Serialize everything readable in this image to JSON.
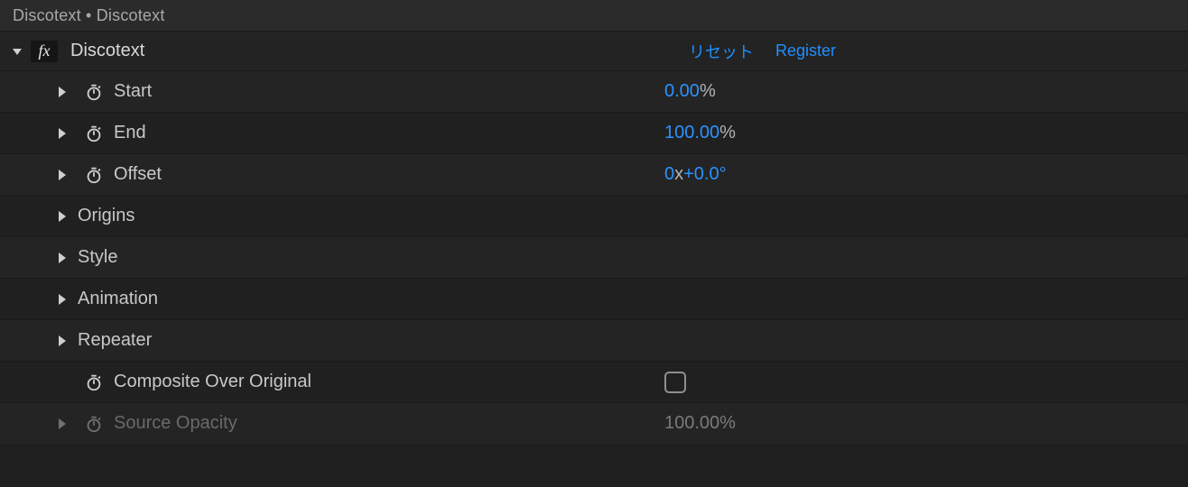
{
  "header": {
    "title": "Discotext • Discotext"
  },
  "effect": {
    "name": "Discotext",
    "reset_label": "リセット",
    "register_label": "Register"
  },
  "props": {
    "start": {
      "label": "Start",
      "value": "0.00",
      "unit": "%"
    },
    "end": {
      "label": "End",
      "value": "100.00",
      "unit": "%"
    },
    "offset": {
      "label": "Offset",
      "revs": "0",
      "x": "x",
      "deg": "+0.0",
      "degsym": "°"
    },
    "origins": {
      "label": "Origins"
    },
    "style": {
      "label": "Style"
    },
    "animation": {
      "label": "Animation"
    },
    "repeater": {
      "label": "Repeater"
    },
    "composite": {
      "label": "Composite Over Original"
    },
    "sourceOpacity": {
      "label": "Source Opacity",
      "value": "100.00",
      "unit": "%"
    }
  }
}
